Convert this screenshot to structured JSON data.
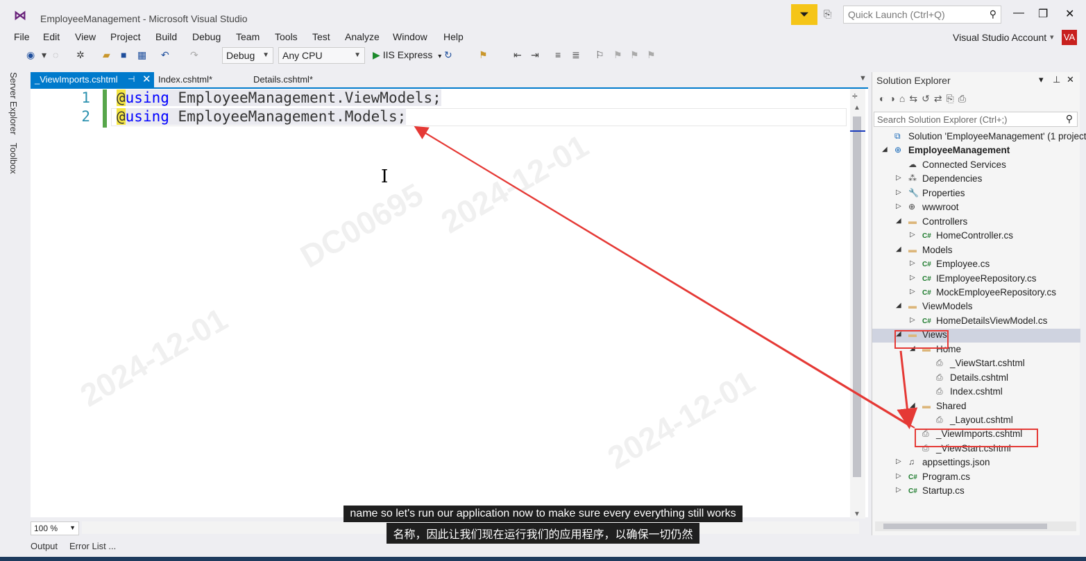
{
  "window": {
    "title": "EmployeeManagement - Microsoft Visual Studio",
    "quick_launch_placeholder": "Quick Launch (Ctrl+Q)",
    "account_label": "Visual Studio Account",
    "avatar_initials": "VA"
  },
  "menu": [
    "File",
    "Edit",
    "View",
    "Project",
    "Build",
    "Debug",
    "Team",
    "Tools",
    "Test",
    "Analyze",
    "Window",
    "Help"
  ],
  "toolbar": {
    "configuration": "Debug",
    "platform": "Any CPU",
    "run_target": "IIS Express"
  },
  "side_tabs": [
    "Server Explorer",
    "Toolbox"
  ],
  "doc_tabs": [
    {
      "label": "_ViewImports.cshtml",
      "active": true
    },
    {
      "label": "Index.cshtml*",
      "active": false
    },
    {
      "label": "Details.cshtml*",
      "active": false
    }
  ],
  "editor": {
    "lines": [
      {
        "no": "1",
        "at": "@",
        "kw": "using",
        "rest": " EmployeeManagement.ViewModels;"
      },
      {
        "no": "2",
        "at": "@",
        "kw": "using",
        "rest": " EmployeeManagement.Models;"
      }
    ],
    "zoom": "100 %"
  },
  "bottom_tabs": [
    "Output",
    "Error List ..."
  ],
  "solution_explorer": {
    "title": "Solution Explorer",
    "search_placeholder": "Search Solution Explorer (Ctrl+;)",
    "tree": [
      {
        "label": "Solution 'EmployeeManagement' (1 project)",
        "level": 0,
        "exp": "",
        "icon": "solution"
      },
      {
        "label": "EmployeeManagement",
        "level": 0,
        "exp": "open",
        "icon": "project",
        "bold": true
      },
      {
        "label": "Connected Services",
        "level": 1,
        "exp": "",
        "icon": "cloud"
      },
      {
        "label": "Dependencies",
        "level": 1,
        "exp": "closed",
        "icon": "deps"
      },
      {
        "label": "Properties",
        "level": 1,
        "exp": "closed",
        "icon": "wrench"
      },
      {
        "label": "wwwroot",
        "level": 1,
        "exp": "closed",
        "icon": "globe"
      },
      {
        "label": "Controllers",
        "level": 1,
        "exp": "open",
        "icon": "folder"
      },
      {
        "label": "HomeController.cs",
        "level": 2,
        "exp": "closed",
        "icon": "cs"
      },
      {
        "label": "Models",
        "level": 1,
        "exp": "open",
        "icon": "folder"
      },
      {
        "label": "Employee.cs",
        "level": 2,
        "exp": "closed",
        "icon": "cs"
      },
      {
        "label": "IEmployeeRepository.cs",
        "level": 2,
        "exp": "closed",
        "icon": "cs"
      },
      {
        "label": "MockEmployeeRepository.cs",
        "level": 2,
        "exp": "closed",
        "icon": "cs"
      },
      {
        "label": "ViewModels",
        "level": 1,
        "exp": "open",
        "icon": "folder"
      },
      {
        "label": "HomeDetailsViewModel.cs",
        "level": 2,
        "exp": "closed",
        "icon": "cs"
      },
      {
        "label": "Views",
        "level": 1,
        "exp": "open",
        "icon": "folder",
        "selected": true
      },
      {
        "label": "Home",
        "level": 2,
        "exp": "open",
        "icon": "folder"
      },
      {
        "label": "_ViewStart.cshtml",
        "level": 3,
        "exp": "",
        "icon": "file"
      },
      {
        "label": "Details.cshtml",
        "level": 3,
        "exp": "",
        "icon": "file"
      },
      {
        "label": "Index.cshtml",
        "level": 3,
        "exp": "",
        "icon": "file"
      },
      {
        "label": "Shared",
        "level": 2,
        "exp": "open",
        "icon": "folder"
      },
      {
        "label": "_Layout.cshtml",
        "level": 3,
        "exp": "",
        "icon": "file"
      },
      {
        "label": "_ViewImports.cshtml",
        "level": 2,
        "exp": "",
        "icon": "file"
      },
      {
        "label": "_ViewStart.cshtml",
        "level": 2,
        "exp": "",
        "icon": "file"
      },
      {
        "label": "appsettings.json",
        "level": 1,
        "exp": "closed",
        "icon": "json"
      },
      {
        "label": "Program.cs",
        "level": 1,
        "exp": "closed",
        "icon": "cs"
      },
      {
        "label": "Startup.cs",
        "level": 1,
        "exp": "closed",
        "icon": "cs"
      }
    ]
  },
  "subtitles": {
    "english": "name so let's run our application now to make sure every everything still works",
    "chinese": "名称，因此让我们现在运行我们的应用程序，以确保一切仍然"
  },
  "watermark": {
    "code": "DC00695",
    "date": "2024-12-01"
  },
  "colors": {
    "accent": "#007acc",
    "annotation": "#e53935",
    "notification": "#f5c518",
    "avatar": "#c8201e"
  }
}
